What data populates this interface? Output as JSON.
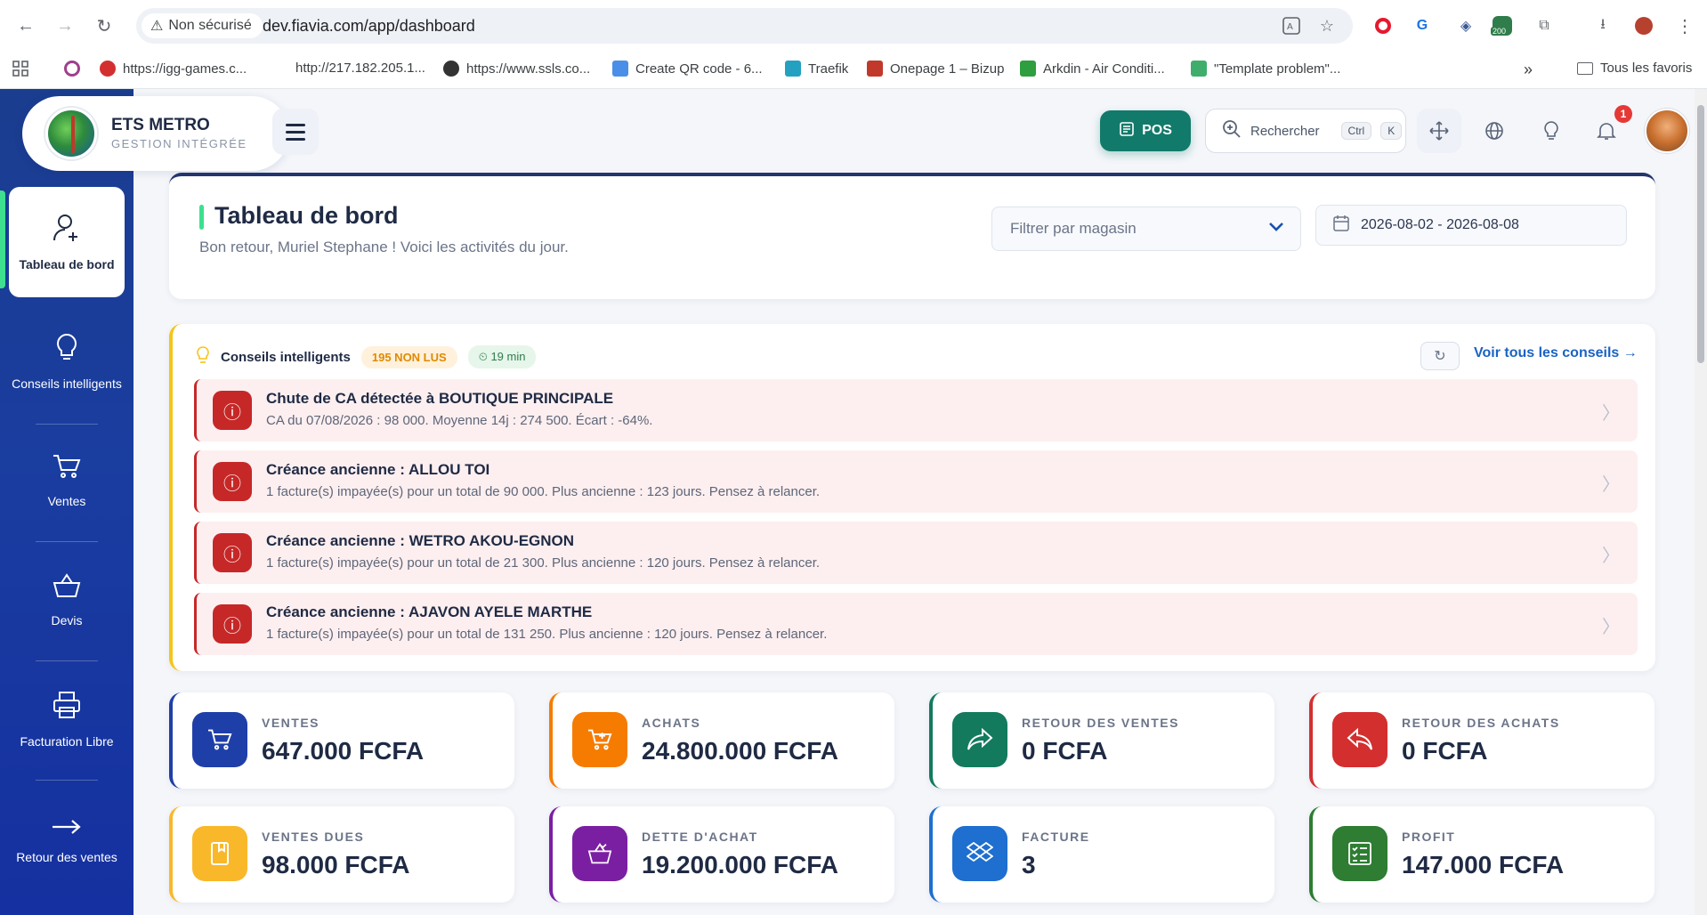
{
  "browser": {
    "security_label": "Non sécurisé",
    "url": "dev.fiavia.com/app/dashboard",
    "ext_badge": "200",
    "bookmarks": [
      {
        "label": "https://igg-games.c...",
        "color": "#d32f2f"
      },
      {
        "label": "http://217.182.205.1...",
        "color": "#ffffff"
      },
      {
        "label": "https://www.ssls.co...",
        "color": "#333333"
      },
      {
        "label": "Create QR code - 6...",
        "color": "#4a8fe7"
      },
      {
        "label": "Traefik",
        "color": "#24a1c1"
      },
      {
        "label": "Onepage 1 – Bizup",
        "color": "#c0392b"
      },
      {
        "label": "Arkdin - Air Conditi...",
        "color": "#2e9e3e"
      },
      {
        "label": "\"Template problem\"...",
        "color": "#3fae6c"
      }
    ],
    "more_label": "»",
    "all_bookmarks": "Tous les favoris"
  },
  "app": {
    "company": "ETS METRO",
    "tagline": "GESTION INTÉGRÉE",
    "pos_label": "POS",
    "search_label": "Rechercher",
    "shortcut_ctrl": "Ctrl",
    "shortcut_k": "K",
    "notif_count": "1"
  },
  "sidebar": {
    "items": [
      {
        "label": "Tableau de bord",
        "icon": "user-add-icon"
      },
      {
        "label": "Conseils intelligents",
        "icon": "lightbulb-icon"
      },
      {
        "label": "Ventes",
        "icon": "cart-icon"
      },
      {
        "label": "Devis",
        "icon": "basket-icon"
      },
      {
        "label": "Facturation Libre",
        "icon": "printer-icon"
      },
      {
        "label": "Retour des ventes",
        "icon": "arrow-right-icon"
      }
    ]
  },
  "page": {
    "title": "Tableau de bord",
    "subtitle": "Bon retour, Muriel Stephane ! Voici les activités du jour.",
    "filter_placeholder": "Filtrer par magasin",
    "date_range": "2026-08-02 - 2026-08-08"
  },
  "tips": {
    "title": "Conseils intelligents",
    "unread": "195 NON LUS",
    "time": "19 min",
    "see_all": "Voir tous les conseils →",
    "items": [
      {
        "title": "Chute de CA détectée à BOUTIQUE PRINCIPALE",
        "desc": "CA du 07/08/2026 : 98 000. Moyenne 14j : 274 500. Écart : -64%."
      },
      {
        "title": "Créance ancienne : ALLOU TOI",
        "desc": "1 facture(s) impayée(s) pour un total de 90 000. Plus ancienne : 123 jours. Pensez à relancer."
      },
      {
        "title": "Créance ancienne : WETRO AKOU-EGNON",
        "desc": "1 facture(s) impayée(s) pour un total de 21 300. Plus ancienne : 120 jours. Pensez à relancer."
      },
      {
        "title": "Créance ancienne : AJAVON AYELE MARTHE",
        "desc": "1 facture(s) impayée(s) pour un total de 131 250. Plus ancienne : 120 jours. Pensez à relancer."
      }
    ]
  },
  "stats": [
    {
      "label": "VENTES",
      "value": "647.000 FCFA",
      "color": "#1f3fa8",
      "icon": "cart-icon"
    },
    {
      "label": "ACHATS",
      "value": "24.800.000 FCFA",
      "color": "#f57c00",
      "icon": "cart-add-icon"
    },
    {
      "label": "RETOUR DES VENTES",
      "value": "0 FCFA",
      "color": "#137a5e",
      "icon": "share-forward-icon"
    },
    {
      "label": "RETOUR DES ACHATS",
      "value": "0 FCFA",
      "color": "#d32f2f",
      "icon": "reply-icon"
    },
    {
      "label": "VENTES DUES",
      "value": "98.000 FCFA",
      "color": "#f9b82a",
      "icon": "book-icon"
    },
    {
      "label": "DETTE D'ACHAT",
      "value": "19.200.000 FCFA",
      "color": "#7b1fa2",
      "icon": "basket-check-icon"
    },
    {
      "label": "FACTURE",
      "value": "3",
      "color": "#1e6fd0",
      "icon": "dropbox-icon"
    },
    {
      "label": "PROFIT",
      "value": "147.000 FCFA",
      "color": "#2e7d32",
      "icon": "checklist-icon"
    }
  ]
}
